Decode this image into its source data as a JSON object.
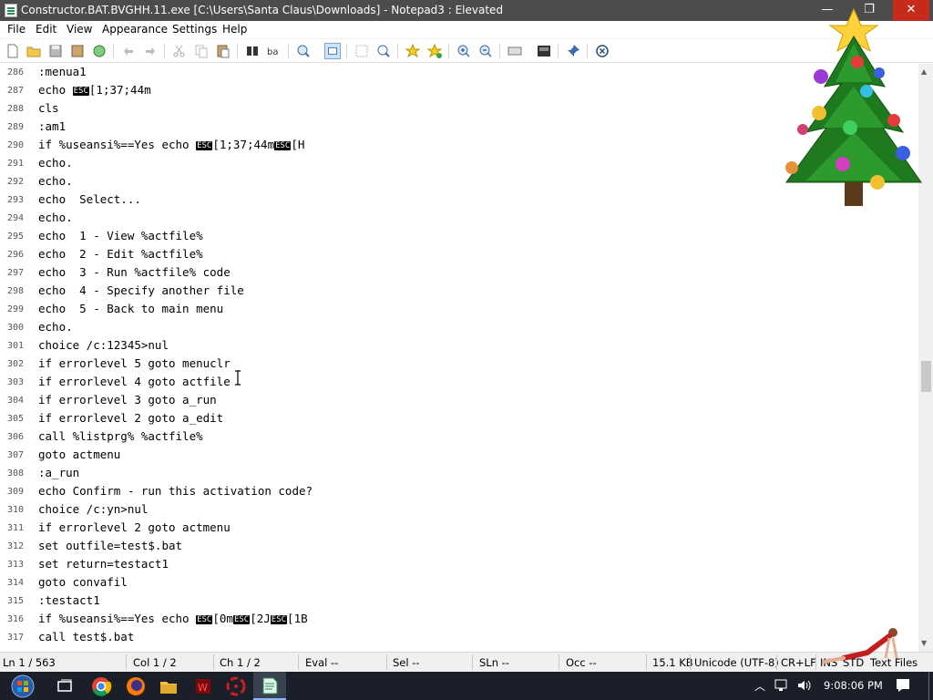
{
  "window": {
    "title": "Constructor.BAT.BVGHH.11.exe [C:\\Users\\Santa Claus\\Downloads] - Notepad3 : Elevated",
    "minimize": "—",
    "maximize": "❐",
    "close": "✕"
  },
  "menu": {
    "file": "File",
    "edit": "Edit",
    "view": "View",
    "appearance": "Appearance",
    "settings": "Settings",
    "help": "Help"
  },
  "toolbar": {
    "icons": [
      "new-file-icon",
      "open-file-icon",
      "save-icon",
      "save-as-icon",
      "browse-icon",
      "undo-icon",
      "redo-icon",
      "cut-icon",
      "copy-icon",
      "paste-icon",
      "find-icon",
      "replace-icon",
      "zoom-find-icon",
      "word-wrap-icon",
      "select-all-icon",
      "find-next-icon",
      "favorite-icon",
      "add-favorite-icon",
      "zoom-in-icon",
      "zoom-out-icon",
      "schema-icon",
      "customize-icon",
      "pin-icon",
      "close-icon"
    ]
  },
  "editor": {
    "esc_label": "ESC",
    "lines": [
      {
        "n": "286",
        "t": ":menua1"
      },
      {
        "n": "287",
        "t": "echo ",
        "esc1": "ESC",
        "t2": "[1;37;44m"
      },
      {
        "n": "288",
        "t": "cls"
      },
      {
        "n": "289",
        "t": ":am1"
      },
      {
        "n": "290",
        "t": "if %useansi%==Yes echo ",
        "esc1": "ESC",
        "t2": "[1;37;44m",
        "esc2": "ESC",
        "t3": "[H"
      },
      {
        "n": "291",
        "t": "echo."
      },
      {
        "n": "292",
        "t": "echo."
      },
      {
        "n": "293",
        "t": "echo  Select..."
      },
      {
        "n": "294",
        "t": "echo."
      },
      {
        "n": "295",
        "t": "echo  1 - View %actfile%"
      },
      {
        "n": "296",
        "t": "echo  2 - Edit %actfile%"
      },
      {
        "n": "297",
        "t": "echo  3 - Run %actfile% code"
      },
      {
        "n": "298",
        "t": "echo  4 - Specify another file"
      },
      {
        "n": "299",
        "t": "echo  5 - Back to main menu"
      },
      {
        "n": "300",
        "t": "echo."
      },
      {
        "n": "301",
        "t": "choice /c:12345>nul"
      },
      {
        "n": "302",
        "t": "if errorlevel 5 goto menuclr"
      },
      {
        "n": "303",
        "t": "if errorlevel 4 goto actfile"
      },
      {
        "n": "304",
        "t": "if errorlevel 3 goto a_run"
      },
      {
        "n": "305",
        "t": "if errorlevel 2 goto a_edit"
      },
      {
        "n": "306",
        "t": "call %listprg% %actfile%"
      },
      {
        "n": "307",
        "t": "goto actmenu"
      },
      {
        "n": "308",
        "t": ":a_run"
      },
      {
        "n": "309",
        "t": "echo Confirm - run this activation code?"
      },
      {
        "n": "310",
        "t": "choice /c:yn>nul"
      },
      {
        "n": "311",
        "t": "if errorlevel 2 goto actmenu"
      },
      {
        "n": "312",
        "t": "set outfile=test$.bat"
      },
      {
        "n": "313",
        "t": "set return=testact1"
      },
      {
        "n": "314",
        "t": "goto convafil"
      },
      {
        "n": "315",
        "t": ":testact1"
      },
      {
        "n": "316",
        "t": "if %useansi%==Yes echo ",
        "esc1": "ESC",
        "t2": "[0m",
        "esc2": "ESC",
        "t3": "[2J",
        "esc3": "ESC",
        "t4": "[1B"
      },
      {
        "n": "317",
        "t": "call test$.bat"
      }
    ]
  },
  "status": {
    "ln": "Ln 1 / 563",
    "col": "Col 1 / 2",
    "ch": "Ch 1 / 2",
    "eval": "Eval --",
    "sel": "Sel --",
    "sln": "SLn --",
    "occ": "Occ --",
    "size": "15.1 KB",
    "encoding": "Unicode (UTF-8)",
    "eol": "CR+LF",
    "ins": "INS",
    "std": "STD",
    "type": "Text Files"
  },
  "taskbar": {
    "clock": "9:08:06 PM",
    "apps": [
      "start-icon",
      "task-view-icon",
      "chrome-icon",
      "firefox-icon",
      "file-explorer-icon",
      "app-red-icon",
      "biohazard-icon",
      "notepad3-icon"
    ]
  },
  "colors": {
    "titlebar": "#4c4c4c",
    "close": "#c42b1c",
    "taskbar": "#1b1f2a",
    "statusbar": "#f0f0f0"
  }
}
